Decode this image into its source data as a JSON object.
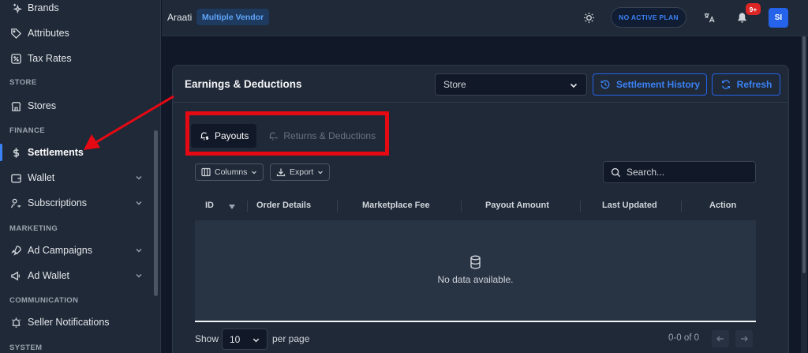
{
  "sidebar": {
    "items": [
      {
        "label": "Brands",
        "icon": "sparkles-icon"
      },
      {
        "label": "Attributes",
        "icon": "tag-icon"
      },
      {
        "label": "Tax Rates",
        "icon": "percent-icon"
      },
      {
        "label": "Stores",
        "icon": "store-icon"
      },
      {
        "label": "Settlements",
        "icon": "dollar-icon"
      },
      {
        "label": "Wallet",
        "icon": "wallet-icon"
      },
      {
        "label": "Subscriptions",
        "icon": "user-key-icon"
      },
      {
        "label": "Ad Campaigns",
        "icon": "rocket-icon"
      },
      {
        "label": "Ad Wallet",
        "icon": "megaphone-icon"
      },
      {
        "label": "Seller Notifications",
        "icon": "alarm-icon"
      }
    ],
    "sections": {
      "store": "STORE",
      "finance": "FINANCE",
      "marketing": "MARKETING",
      "communication": "COMMUNICATION",
      "system": "SYSTEM"
    }
  },
  "topbar": {
    "brand": "Araati",
    "vendor_badge": "Multiple Vendor",
    "plan": "NO ACTIVE PLAN",
    "notifications_badge": "9+",
    "avatar_initials": "SI"
  },
  "card": {
    "title": "Earnings & Deductions",
    "store_select": "Store",
    "settlement_history_label": "Settlement History",
    "refresh_label": "Refresh",
    "tabs": [
      {
        "label": "Payouts",
        "active": true
      },
      {
        "label": "Returns & Deductions",
        "active": false
      }
    ],
    "columns_label": "Columns",
    "export_label": "Export",
    "search_placeholder": "Search...",
    "table": {
      "headers": [
        "ID",
        "Order Details",
        "Marketplace Fee",
        "Payout Amount",
        "Last Updated",
        "Action"
      ],
      "empty_text": "No data available."
    },
    "footer": {
      "show": "Show",
      "per_page_value": "10",
      "per_page": "per page",
      "range": "0-0 of 0"
    }
  },
  "colors": {
    "accent": "#3b82f6",
    "highlight": "#e50914",
    "badge": "#dc2626",
    "sidebar_bg": "#1f2937",
    "page_bg": "#111827"
  }
}
